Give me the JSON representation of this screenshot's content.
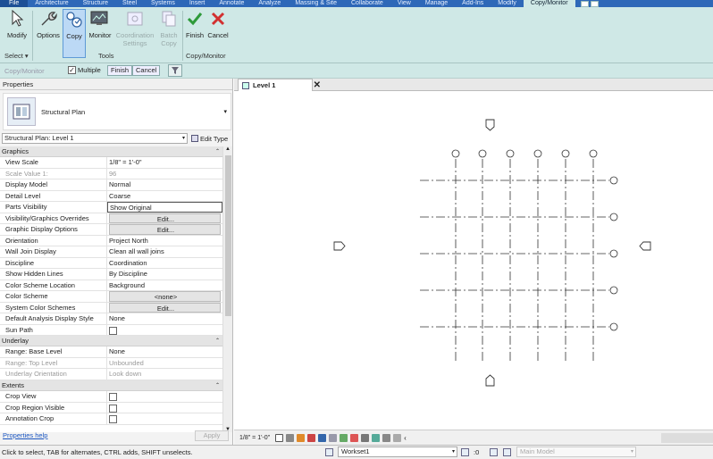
{
  "ribbon_tabs": [
    "File",
    "Architecture",
    "Structure",
    "Steel",
    "Systems",
    "Insert",
    "Annotate",
    "Analyze",
    "Massing & Site",
    "Collaborate",
    "View",
    "Manage",
    "Add-Ins",
    "Modify",
    "Copy/Monitor"
  ],
  "active_tab": "Copy/Monitor",
  "ribbon": {
    "modify": "Modify",
    "options": "Options",
    "copy": "Copy",
    "monitor": "Monitor",
    "coordination_settings_1": "Coordination",
    "coordination_settings_2": "Settings",
    "batch_copy_1": "Batch",
    "batch_copy_2": "Copy",
    "finish": "Finish",
    "cancel": "Cancel",
    "panel_select": "Select ▾",
    "panel_tools": "Tools",
    "panel_copy_monitor": "Copy/Monitor"
  },
  "options_bar": {
    "context": "Copy/Monitor",
    "multiple_label": "Multiple",
    "multiple_checked": true,
    "finish": "Finish",
    "cancel": "Cancel"
  },
  "properties": {
    "title": "Properties",
    "type_name": "Structural Plan",
    "instance_selector": "Structural Plan: Level 1",
    "edit_type": "Edit Type",
    "groups": [
      {
        "name": "Graphics",
        "rows": [
          {
            "k": "View Scale",
            "v": "1/8\" = 1'-0\"",
            "style": "plain"
          },
          {
            "k": "Scale Value    1:",
            "v": "96",
            "style": "disabled"
          },
          {
            "k": "Display Model",
            "v": "Normal",
            "style": "plain"
          },
          {
            "k": "Detail Level",
            "v": "Coarse",
            "style": "plain"
          },
          {
            "k": "Parts Visibility",
            "v": "Show Original",
            "style": "boxed"
          },
          {
            "k": "Visibility/Graphics Overrides",
            "v": "Edit...",
            "style": "button"
          },
          {
            "k": "Graphic Display Options",
            "v": "Edit...",
            "style": "button"
          },
          {
            "k": "Orientation",
            "v": "Project North",
            "style": "plain"
          },
          {
            "k": "Wall Join Display",
            "v": "Clean all wall joins",
            "style": "plain"
          },
          {
            "k": "Discipline",
            "v": "Coordination",
            "style": "plain"
          },
          {
            "k": "Show Hidden Lines",
            "v": "By Discipline",
            "style": "plain"
          },
          {
            "k": "Color Scheme Location",
            "v": "Background",
            "style": "plain"
          },
          {
            "k": "Color Scheme",
            "v": "<none>",
            "style": "button"
          },
          {
            "k": "System Color Schemes",
            "v": "Edit...",
            "style": "button"
          },
          {
            "k": "Default Analysis Display Style",
            "v": "None",
            "style": "plain"
          },
          {
            "k": "Sun Path",
            "v": "",
            "style": "checkbox"
          }
        ]
      },
      {
        "name": "Underlay",
        "rows": [
          {
            "k": "Range: Base Level",
            "v": "None",
            "style": "plain"
          },
          {
            "k": "Range: Top Level",
            "v": "Unbounded",
            "style": "disabled"
          },
          {
            "k": "Underlay Orientation",
            "v": "Look down",
            "style": "disabled"
          }
        ]
      },
      {
        "name": "Extents",
        "rows": [
          {
            "k": "Crop View",
            "v": "",
            "style": "checkbox"
          },
          {
            "k": "Crop Region Visible",
            "v": "",
            "style": "checkbox"
          },
          {
            "k": "Annotation Crop",
            "v": "",
            "style": "checkbox"
          }
        ]
      }
    ],
    "help_link": "Properties help",
    "apply": "Apply"
  },
  "view": {
    "tab_name": "Level 1",
    "scale_label": "1/8\" = 1'-0\""
  },
  "status_bar": {
    "message": "Click to select, TAB for alternates, CTRL adds, SHIFT unselects.",
    "workset": "Workset1",
    "count": ":0",
    "model": "Main Model"
  }
}
